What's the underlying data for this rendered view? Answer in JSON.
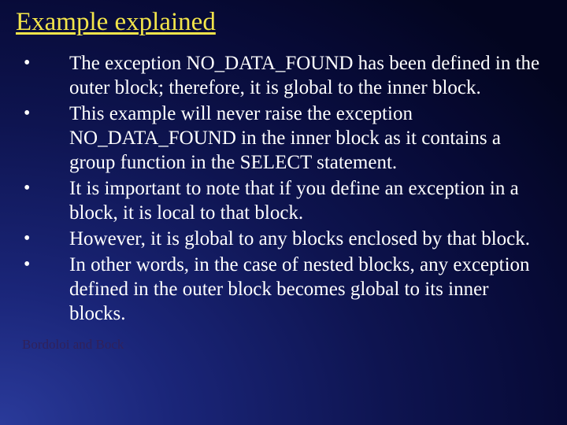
{
  "title": "Example explained",
  "bullets": [
    {
      "marker": "•",
      "text": "The exception NO_DATA_FOUND has been defined in the outer block; therefore, it is global to the inner block."
    },
    {
      "marker": "•",
      "text": "This example will never raise the exception NO_DATA_FOUND in the inner block as it contains a group function in the SELECT statement."
    },
    {
      "marker": "•",
      "text": "It is important to note that if you define an exception in a block, it is local to that block."
    },
    {
      "marker": "•",
      "text": "However, it is global to any blocks enclosed by that block."
    },
    {
      "marker": "•",
      "text": "In other words, in the case of nested blocks, any exception defined in the outer block becomes global to its inner blocks."
    }
  ],
  "footer": "Bordoloi and Bock"
}
